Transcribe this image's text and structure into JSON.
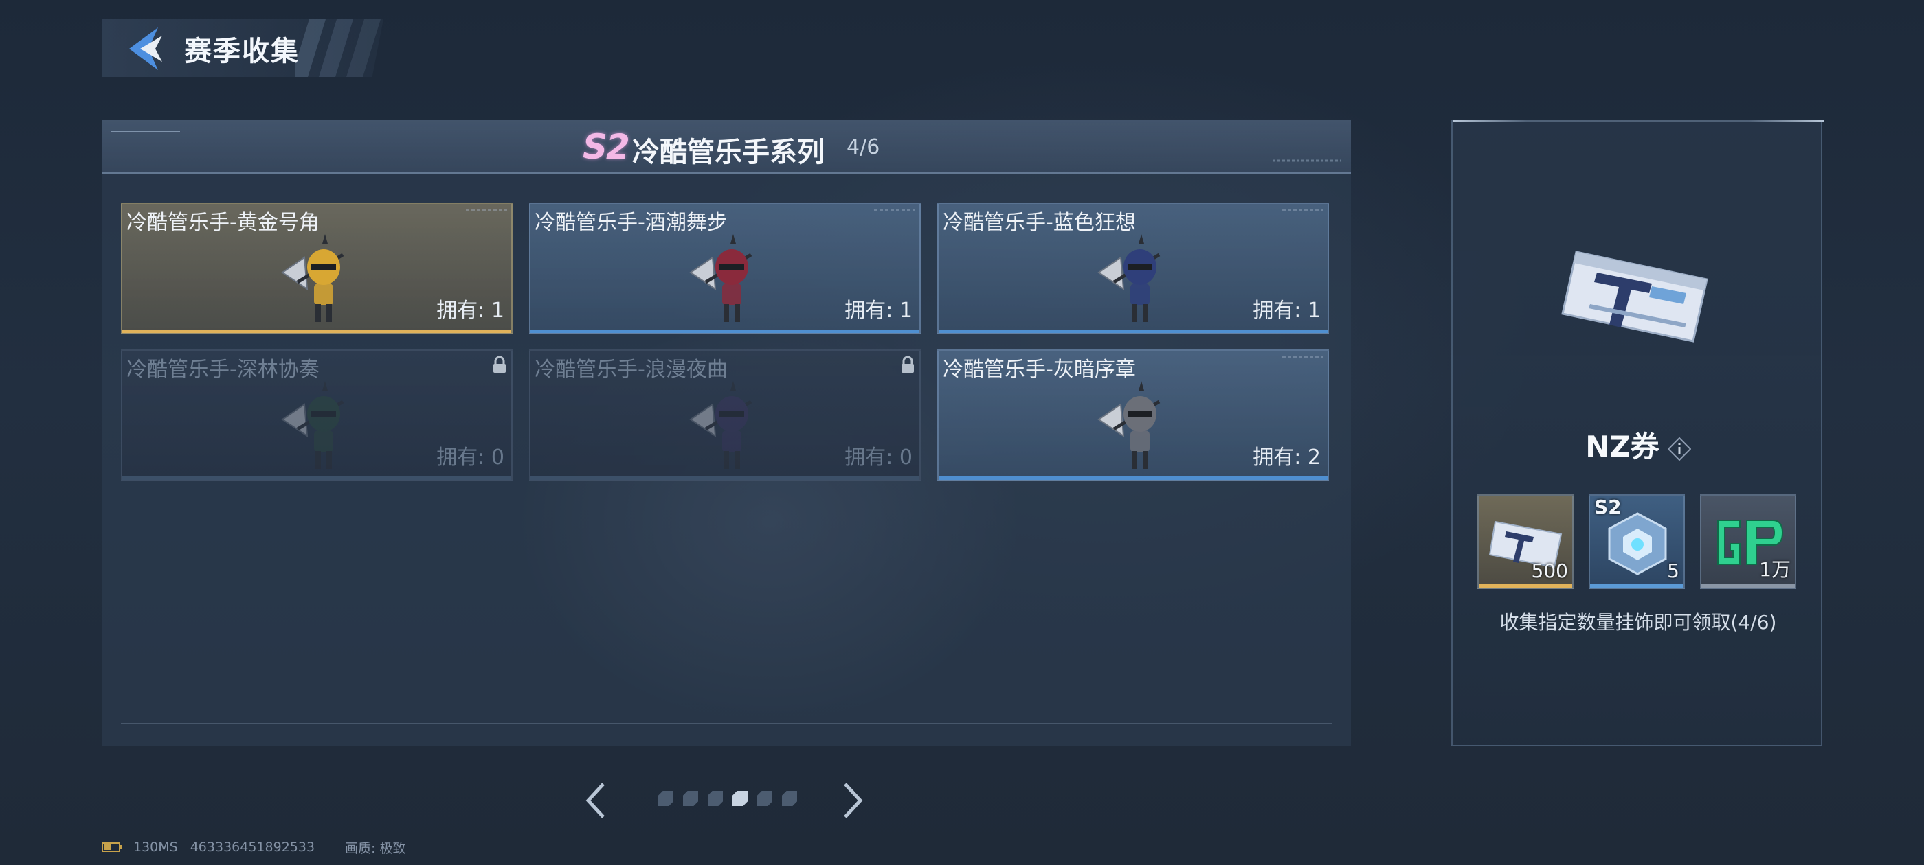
{
  "header": {
    "title": "赛季收集",
    "back_icon": "back-arrow-icon"
  },
  "series": {
    "badge": "S2",
    "title": "冷酷管乐手系列",
    "progress": "4/6"
  },
  "cards": [
    {
      "name": "冷酷管乐手-黄金号角",
      "owned": "拥有: 1",
      "rarity": "gold",
      "locked": false,
      "color": "#d8a733"
    },
    {
      "name": "冷酷管乐手-酒潮舞步",
      "owned": "拥有: 1",
      "rarity": "blue",
      "locked": false,
      "color": "#8a2a3c"
    },
    {
      "name": "冷酷管乐手-蓝色狂想",
      "owned": "拥有: 1",
      "rarity": "blue",
      "locked": false,
      "color": "#2f3f7a"
    },
    {
      "name": "冷酷管乐手-深林协奏",
      "owned": "拥有: 0",
      "rarity": "blue",
      "locked": true,
      "color": "#2b4a3e"
    },
    {
      "name": "冷酷管乐手-浪漫夜曲",
      "owned": "拥有: 0",
      "rarity": "blue",
      "locked": true,
      "color": "#3b3560"
    },
    {
      "name": "冷酷管乐手-灰暗序章",
      "owned": "拥有: 2",
      "rarity": "blue",
      "locked": false,
      "color": "#6b6f78"
    }
  ],
  "pager": {
    "total": 6,
    "active_index": 3
  },
  "reward": {
    "name": "NZ券",
    "items": [
      {
        "qty": "500",
        "tag": "",
        "rarity": "gold",
        "icon": "nz-ticket-icon"
      },
      {
        "qty": "5",
        "tag": "S2",
        "rarity": "blue",
        "icon": "crystal-box-icon"
      },
      {
        "qty": "1万",
        "tag": "",
        "rarity": "gray",
        "icon": "gp-coin-icon"
      }
    ],
    "description": "收集指定数量挂饰即可领取(4/6)"
  },
  "status": {
    "latency": "130MS",
    "uid": "463336451892533",
    "quality_label": "画质:",
    "quality_value": "极致"
  },
  "colors": {
    "accent_gold": "#e0b25a",
    "accent_blue": "#4f8fd0",
    "season_pink": "#f3b8e6"
  }
}
